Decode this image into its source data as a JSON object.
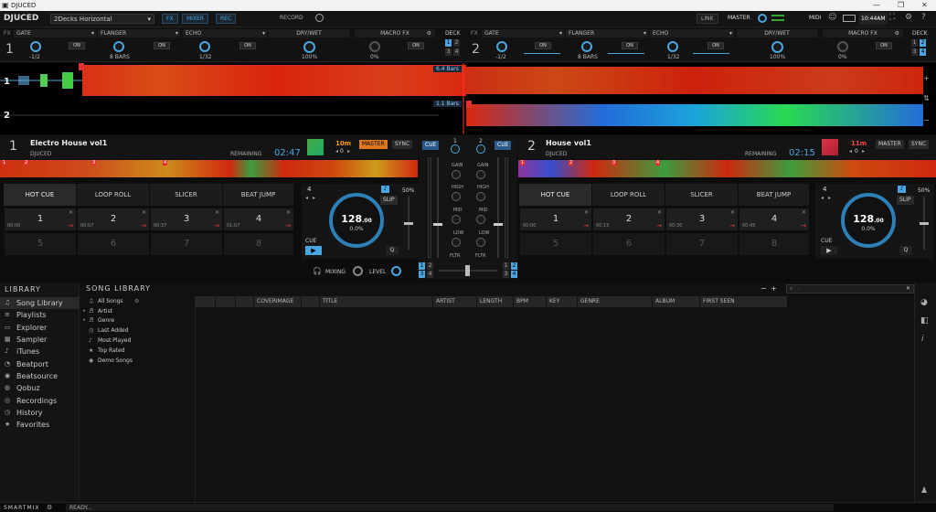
{
  "window": {
    "title": "DJUCED"
  },
  "topbar": {
    "logo": "DJUCED",
    "preset": "2Decks Horizontal",
    "fx": "FX",
    "mixer": "MIXER",
    "rec": "REC",
    "record": "RECORD",
    "link": "LINK",
    "master": "MASTER",
    "midi": "MIDI",
    "time": "10:44AM"
  },
  "fx": {
    "label": "FX",
    "deck_label": "DECK",
    "dry_wet": "DRY/WET",
    "macro": "MACRO FX",
    "on": "ON",
    "deck1": {
      "num": "1",
      "slots": [
        {
          "name": "GATE",
          "val": "-1/2"
        },
        {
          "name": "FLANGER",
          "val": "8 BARS"
        },
        {
          "name": "ECHO",
          "val": "1/32"
        }
      ],
      "drywet_val": "100%",
      "macro_val": "0%"
    },
    "deck2": {
      "num": "2",
      "slots": [
        {
          "name": "GATE",
          "val": "-1/2"
        },
        {
          "name": "FLANGER",
          "val": "8 BARS"
        },
        {
          "name": "ECHO",
          "val": "1/32"
        }
      ],
      "drywet_val": "100%",
      "macro_val": "0%"
    }
  },
  "waves": {
    "deck1_num": "1",
    "deck2_num": "2",
    "bars_top": "6.4 Bars",
    "bars_bottom": "1.1 Bars"
  },
  "deck1": {
    "num": "1",
    "title": "Electro House vol1",
    "artist": "DJUCED",
    "remaining_label": "REMAINING",
    "remaining": "02:47",
    "key": "10m",
    "master": "MASTER",
    "sync": "SYNC",
    "pitch": "0",
    "tabs": [
      "HOT CUE",
      "LOOP ROLL",
      "SLICER",
      "BEAT JUMP"
    ],
    "pads": [
      {
        "n": "1",
        "t": "00:00"
      },
      {
        "n": "2",
        "t": "00:07"
      },
      {
        "n": "3",
        "t": "00:37"
      },
      {
        "n": "4",
        "t": "01:07"
      }
    ],
    "pads2": [
      "5",
      "6",
      "7",
      "8"
    ],
    "loop": "4",
    "slip": "SLIP",
    "pct": "50%",
    "bpm": "128",
    "bpm_dec": ".00",
    "bpm_pct": "0.0%",
    "cue": "CUE",
    "q": "Q"
  },
  "deck2": {
    "num": "2",
    "title": "House vol1",
    "artist": "DJUCED",
    "remaining_label": "REMAINING",
    "remaining": "02:15",
    "key": "11m",
    "master": "MASTER",
    "sync": "SYNC",
    "pitch": "0",
    "tabs": [
      "HOT CUE",
      "LOOP ROLL",
      "SLICER",
      "BEAT JUMP"
    ],
    "pads": [
      {
        "n": "1",
        "t": "00:00"
      },
      {
        "n": "2",
        "t": "00:15"
      },
      {
        "n": "3",
        "t": "00:30"
      },
      {
        "n": "4",
        "t": "00:45"
      }
    ],
    "pads2": [
      "5",
      "6",
      "7",
      "8"
    ],
    "loop": "4",
    "slip": "SLIP",
    "pct": "50%",
    "bpm": "128",
    "bpm_dec": ".00",
    "bpm_pct": "0.0%",
    "cue": "CUE",
    "q": "Q"
  },
  "mixer": {
    "cue": "CUE",
    "num1": "1",
    "num2": "2",
    "gain": "GAIN",
    "high": "HIGH",
    "mid": "MID",
    "low": "LOW",
    "fltr": "FLTR",
    "mixing": "MIXING",
    "level": "LEVEL"
  },
  "library": {
    "title": "LIBRARY",
    "items": [
      {
        "label": "Song Library",
        "icon": "♫"
      },
      {
        "label": "Playlists",
        "icon": "≡"
      },
      {
        "label": "Explorer",
        "icon": "▭"
      },
      {
        "label": "Sampler",
        "icon": "▦"
      },
      {
        "label": "iTunes",
        "icon": "♪"
      },
      {
        "label": "Beatport",
        "icon": "◔"
      },
      {
        "label": "Beatsource",
        "icon": "◉"
      },
      {
        "label": "Qobuz",
        "icon": "◍"
      },
      {
        "label": "Recordings",
        "icon": "◎"
      },
      {
        "label": "History",
        "icon": "◷"
      },
      {
        "label": "Favorites",
        "icon": "★"
      }
    ],
    "song_library": "SONG LIBRARY",
    "tree": [
      {
        "label": "All Songs",
        "icon": "♫"
      },
      {
        "label": "Artist",
        "icon": "♬"
      },
      {
        "label": "Genre",
        "icon": "♬"
      },
      {
        "label": "Last Added",
        "icon": "◷"
      },
      {
        "label": "Most Played",
        "icon": "♪"
      },
      {
        "label": "Top Rated",
        "icon": "★"
      },
      {
        "label": "Demo Songs",
        "icon": "◉"
      }
    ],
    "columns": [
      "",
      "",
      "",
      "COVERIMAGE",
      "",
      "TITLE",
      "ARTIST",
      "LENGTH",
      "BPM",
      "KEY",
      "GENRE",
      "ALBUM",
      "FIRST SEEN"
    ],
    "search_placeholder": "-"
  },
  "status": {
    "smartmix": "SMARTMIX",
    "ready": "READY..."
  }
}
